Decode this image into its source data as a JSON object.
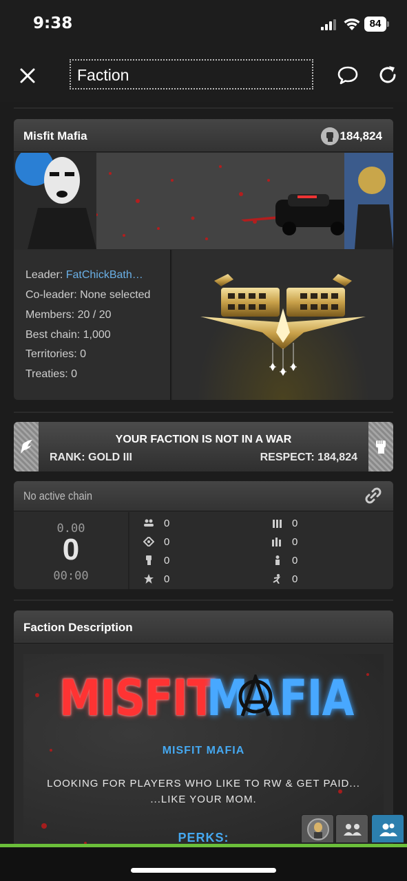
{
  "status": {
    "time": "9:38",
    "battery": "84"
  },
  "nav": {
    "title": "Faction"
  },
  "faction": {
    "name": "Misfit Mafia",
    "respect": "184,824",
    "info": {
      "leader_label": "Leader: ",
      "leader_name": "FatChickBath…",
      "coleader": "Co-leader: None selected",
      "members": "Members: 20 / 20",
      "best_chain": "Best chain: 1,000",
      "territories": "Territories: 0",
      "treaties": "Treaties: 0"
    }
  },
  "war": {
    "headline": "YOUR FACTION IS NOT IN A WAR",
    "rank": "RANK: GOLD III",
    "respect": "RESPECT: 184,824"
  },
  "chain": {
    "title": "No active chain",
    "timeout": "0.00",
    "count": "0",
    "timer": "00:00",
    "stats_left": [
      "0",
      "0",
      "0",
      "0"
    ],
    "stats_right": [
      "0",
      "0",
      "0",
      "0"
    ]
  },
  "description": {
    "title": "Faction Description",
    "logo_left": "MISFIT",
    "logo_right": "MAFIA",
    "subtitle": "MISFIT MAFIA",
    "line1": "LOOKING FOR PLAYERS WHO LIKE TO RW & GET PAID...",
    "line2": "...LIKE YOUR MOM.",
    "perks": "PERKS:"
  },
  "colors": {
    "link": "#6ab0e6",
    "accent_blue": "#45a8f0",
    "accent_red": "#ff3333",
    "active_tab": "#2c7fae",
    "progress": "#6bbf3a"
  }
}
